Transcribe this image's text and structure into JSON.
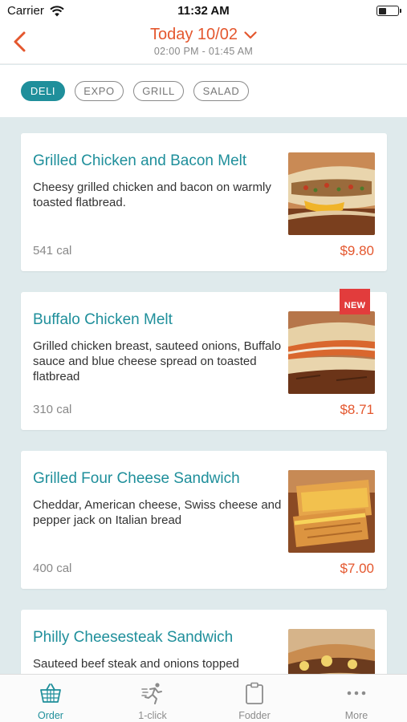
{
  "status_bar": {
    "carrier": "Carrier",
    "time": "11:32 AM",
    "battery_level": 0.45
  },
  "header": {
    "title": "Today 10/02",
    "subtitle": "02:00 PM - 01:45 AM"
  },
  "filters": [
    {
      "label": "DELI",
      "active": true
    },
    {
      "label": "EXPO",
      "active": false
    },
    {
      "label": "GRILL",
      "active": false
    },
    {
      "label": "SALAD",
      "active": false
    }
  ],
  "menu_items": [
    {
      "name": "Grilled Chicken and Bacon Melt",
      "description": "Cheesy grilled chicken and bacon on warmly toasted flatbread.",
      "calories": "541 cal",
      "price": "$9.80",
      "badge": ""
    },
    {
      "name": "Buffalo Chicken Melt",
      "description": "Grilled chicken breast, sauteed onions, Buffalo sauce and blue cheese spread on toasted flatbread",
      "calories": "310 cal",
      "price": "$8.71",
      "badge": "NEW"
    },
    {
      "name": "Grilled Four Cheese Sandwich",
      "description": "Cheddar, American cheese, Swiss cheese and pepper jack on Italian bread",
      "calories": "400 cal",
      "price": "$7.00",
      "badge": ""
    },
    {
      "name": "Philly Cheesesteak Sandwich",
      "description": "Sauteed beef steak and onions topped",
      "calories": "",
      "price": "",
      "badge": ""
    }
  ],
  "tabs": [
    {
      "label": "Order",
      "icon": "basket-icon",
      "active": true
    },
    {
      "label": "1-click",
      "icon": "running-person-icon",
      "active": false
    },
    {
      "label": "Fodder",
      "icon": "clipboard-icon",
      "active": false
    },
    {
      "label": "More",
      "icon": "more-dots-icon",
      "active": false
    }
  ],
  "colors": {
    "accent": "#1f8f9b",
    "highlight": "#e4572e",
    "badge": "#e23c3c",
    "background": "#dfeaec"
  }
}
